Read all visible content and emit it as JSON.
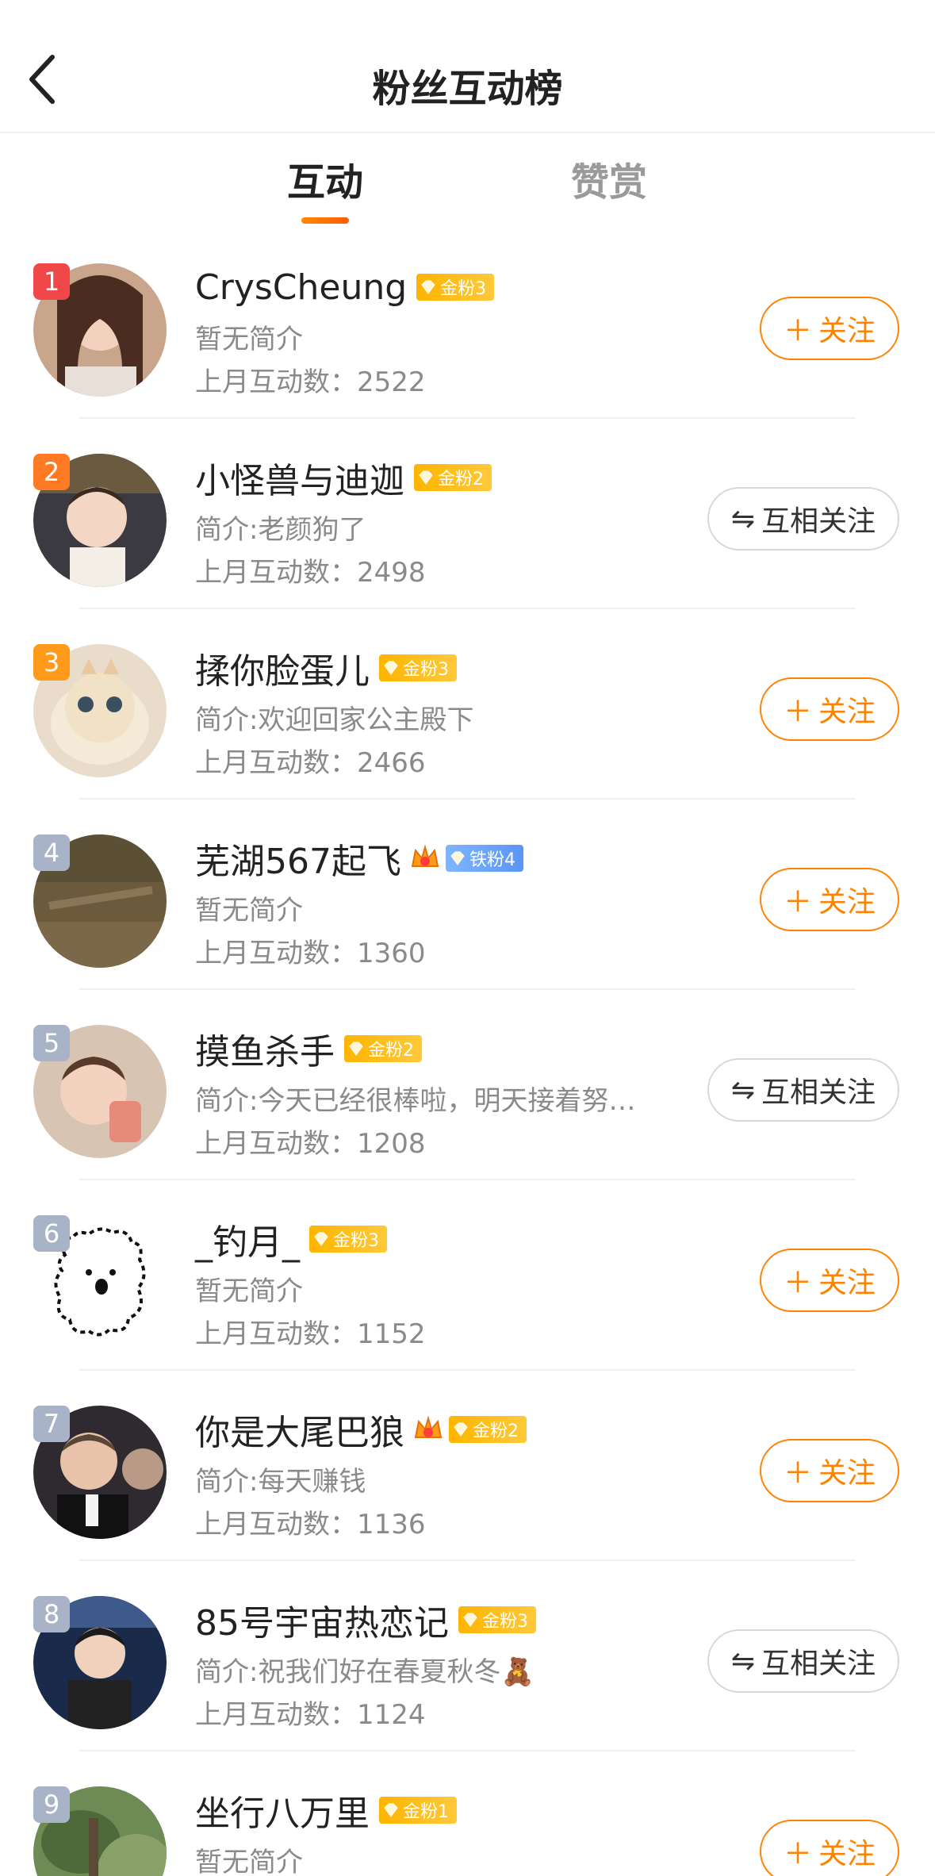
{
  "header": {
    "title": "粉丝互动榜"
  },
  "tabs": [
    {
      "label": "互动"
    },
    {
      "label": "赞赏"
    }
  ],
  "count_prefix": "上月互动数：",
  "buttons": {
    "follow": "关注",
    "mutual": "互相关注"
  },
  "colors": {
    "accent": "#ff8200",
    "rank1": "#f04848",
    "rank2": "#ff7a22",
    "rank3": "#ff9a1a",
    "rank_other": "#a9b3c7",
    "gold_badge": "#ffb400",
    "iron_badge": "#5a95f5"
  },
  "fans": [
    {
      "rank": "1",
      "name": "CrysCheung",
      "badge": "金粉3",
      "badge_type": "gold",
      "intro": "暂无简介",
      "count": "2522",
      "button": "follow"
    },
    {
      "rank": "2",
      "name": "小怪兽与迪迦",
      "badge": "金粉2",
      "badge_type": "gold",
      "intro": "简介:老颜狗了",
      "count": "2498",
      "button": "mutual"
    },
    {
      "rank": "3",
      "name": "揉你脸蛋儿",
      "badge": "金粉3",
      "badge_type": "gold",
      "intro": "简介:欢迎回家公主殿下",
      "count": "2466",
      "button": "follow"
    },
    {
      "rank": "4",
      "name": "芜湖567起飞",
      "badge": "铁粉4",
      "badge_type": "iron",
      "crown": true,
      "intro": "暂无简介",
      "count": "1360",
      "button": "follow"
    },
    {
      "rank": "5",
      "name": "摸鱼杀手",
      "badge": "金粉2",
      "badge_type": "gold",
      "intro": "简介:今天已经很棒啦，明天接着努…",
      "count": "1208",
      "button": "mutual"
    },
    {
      "rank": "6",
      "name": "_钓月_",
      "badge": "金粉3",
      "badge_type": "gold",
      "intro": "暂无简介",
      "count": "1152",
      "button": "follow"
    },
    {
      "rank": "7",
      "name": "你是大尾巴狼",
      "badge": "金粉2",
      "badge_type": "gold",
      "crown": true,
      "intro": "简介:每天赚钱",
      "count": "1136",
      "button": "follow"
    },
    {
      "rank": "8",
      "name": "85号宇宙热恋记",
      "badge": "金粉3",
      "badge_type": "gold",
      "intro": "简介:祝我们好在春夏秋冬🧸",
      "count": "1124",
      "button": "mutual"
    },
    {
      "rank": "9",
      "name": "坐行八万里",
      "badge": "金粉1",
      "badge_type": "gold",
      "intro": "暂无简介",
      "count": "",
      "button": "follow"
    }
  ]
}
